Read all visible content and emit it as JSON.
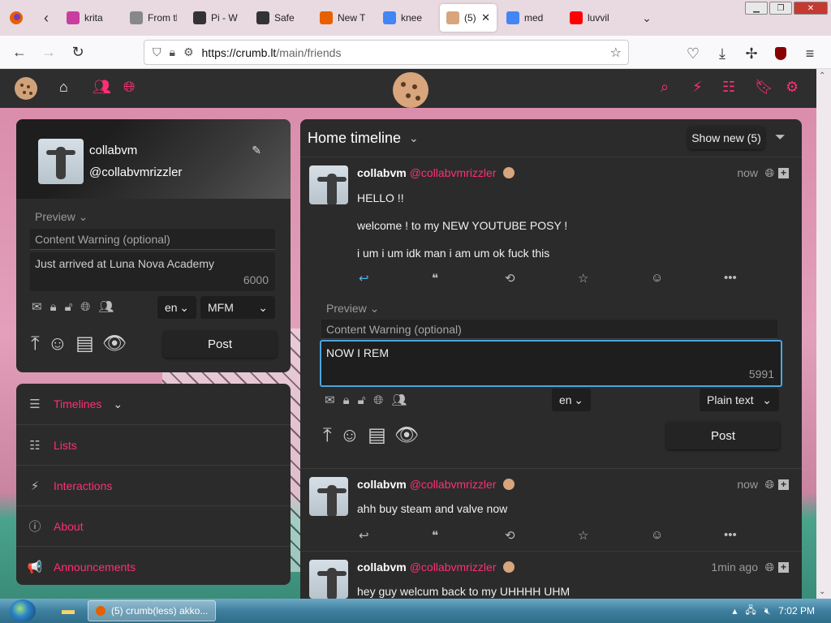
{
  "browser": {
    "tabs": [
      {
        "title": "krita",
        "favicon": "krita-icon",
        "color": "#c83ea0"
      },
      {
        "title": "From the",
        "favicon": "page-icon",
        "color": "#888888"
      },
      {
        "title": "Pi - W",
        "favicon": "wikipedia-icon",
        "color": "#333333"
      },
      {
        "title": "Safe",
        "favicon": "wikipedia-icon",
        "color": "#333333"
      },
      {
        "title": "New T",
        "favicon": "firefox-icon",
        "color": "#e66000"
      },
      {
        "title": "knee",
        "favicon": "google-icon",
        "color": "#4285f4"
      },
      {
        "title": "(5)",
        "favicon": "cookie-icon",
        "color": "#d8a57c",
        "active": true
      },
      {
        "title": "med",
        "favicon": "google-icon",
        "color": "#4285f4"
      },
      {
        "title": "luvvil",
        "favicon": "youtube-icon",
        "color": "#ff0000"
      }
    ],
    "url_host": "https://crumb.lt",
    "url_path": "/main/friends"
  },
  "user": {
    "display_name": "collabvm",
    "handle": "@collabvmrizzler"
  },
  "compose": {
    "preview_label": "Preview",
    "cw_placeholder": "Content Warning (optional)",
    "text": "Just arrived at Luna Nova Academy",
    "char_count": "6000",
    "language": "en",
    "format": "MFM",
    "post_label": "Post"
  },
  "sidenav": [
    {
      "label": "Timelines",
      "icon": "menu-icon",
      "glyph": "☰"
    },
    {
      "label": "Lists",
      "icon": "list-icon",
      "glyph": "☷"
    },
    {
      "label": "Interactions",
      "icon": "bolt-icon",
      "glyph": "⚡"
    },
    {
      "label": "About",
      "icon": "info-icon",
      "glyph": "ⓘ"
    },
    {
      "label": "Announcements",
      "icon": "megaphone-icon",
      "glyph": "📢"
    }
  ],
  "timeline": {
    "title": "Home timeline",
    "show_new": "Show new (5)",
    "statuses": [
      {
        "name": "collabvm",
        "handle": "@collabvmrizzler",
        "time": "now",
        "lines": [
          "HELLO !!",
          "welcome ! to my NEW YOUTUBE POSY !",
          "i um i um idk man i am um ok fuck this"
        ]
      },
      {
        "name": "collabvm",
        "handle": "@collabvmrizzler",
        "time": "now",
        "lines": [
          "ahh buy steam and valve now"
        ]
      },
      {
        "name": "collabvm",
        "handle": "@collabvmrizzler",
        "time": "1min ago",
        "lines": [
          "hey guy welcum back to my UHHHH UHM"
        ]
      }
    ]
  },
  "reply": {
    "preview_label": "Preview",
    "cw_placeholder": "Content Warning (optional)",
    "text": "NOW I REM",
    "char_count": "5991",
    "language": "en",
    "format": "Plain text",
    "post_label": "Post"
  },
  "taskbar": {
    "task_label": "(5) crumb(less) akko...",
    "clock": "7:02 PM"
  },
  "colors": {
    "accent": "#ff2f74",
    "panel": "#2b2b2b"
  }
}
